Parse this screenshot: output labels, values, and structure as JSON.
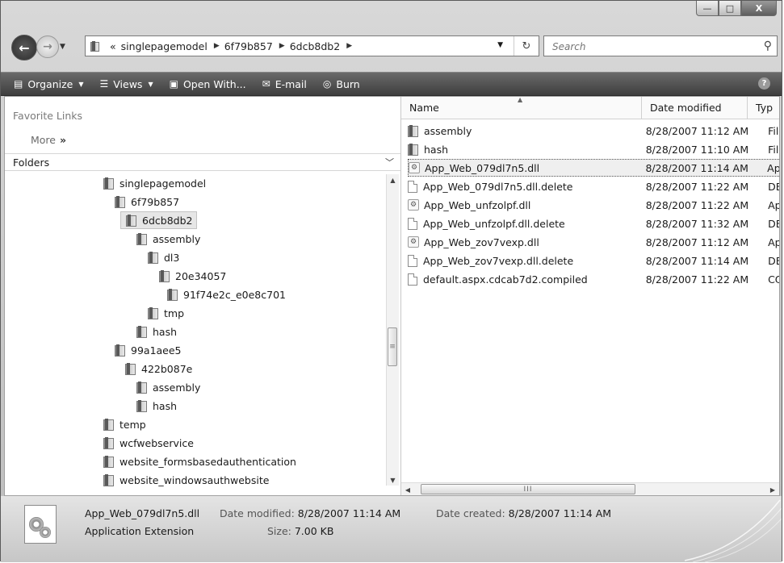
{
  "window": {
    "minimize_label": "—",
    "maximize_label": "□",
    "close_label": "X"
  },
  "address": {
    "overflow": "«",
    "crumbs": [
      "singlepagemodel",
      "6f79b857",
      "6dcb8db2"
    ],
    "refresh": "↻"
  },
  "search": {
    "placeholder": "Search"
  },
  "toolbar": {
    "organize": "Organize",
    "views": "Views",
    "open_with": "Open With...",
    "email": "E-mail",
    "burn": "Burn",
    "help": "?"
  },
  "nav": {
    "favorite_links": "Favorite Links",
    "more": "More",
    "more_chevron": "»",
    "folders": "Folders",
    "tree": [
      {
        "label": "singlepagemodel"
      },
      {
        "label": "6f79b857"
      },
      {
        "label": "6dcb8db2",
        "selected": true
      },
      {
        "label": "assembly"
      },
      {
        "label": "dl3"
      },
      {
        "label": "20e34057"
      },
      {
        "label": "91f74e2c_e0e8c701"
      },
      {
        "label": "tmp"
      },
      {
        "label": "hash"
      },
      {
        "label": "99a1aee5"
      },
      {
        "label": "422b087e"
      },
      {
        "label": "assembly"
      },
      {
        "label": "hash"
      },
      {
        "label": "temp"
      },
      {
        "label": "wcfwebservice"
      },
      {
        "label": "website_formsbasedauthentication"
      },
      {
        "label": "website_windowsauthwebsite"
      }
    ]
  },
  "files": {
    "columns": {
      "name": "Name",
      "date": "Date modified",
      "type": "Typ"
    },
    "rows": [
      {
        "name": "assembly",
        "date": "8/28/2007 11:12 AM",
        "type": "File",
        "kind": "folder"
      },
      {
        "name": "hash",
        "date": "8/28/2007 11:10 AM",
        "type": "File",
        "kind": "folder"
      },
      {
        "name": "App_Web_079dl7n5.dll",
        "date": "8/28/2007 11:14 AM",
        "type": "Ap",
        "kind": "dll",
        "selected": true
      },
      {
        "name": "App_Web_079dl7n5.dll.delete",
        "date": "8/28/2007 11:22 AM",
        "type": "DE",
        "kind": "file"
      },
      {
        "name": "App_Web_unfzolpf.dll",
        "date": "8/28/2007 11:22 AM",
        "type": "Ap",
        "kind": "dll"
      },
      {
        "name": "App_Web_unfzolpf.dll.delete",
        "date": "8/28/2007 11:32 AM",
        "type": "DE",
        "kind": "file"
      },
      {
        "name": "App_Web_zov7vexp.dll",
        "date": "8/28/2007 11:12 AM",
        "type": "Ap",
        "kind": "dll"
      },
      {
        "name": "App_Web_zov7vexp.dll.delete",
        "date": "8/28/2007 11:14 AM",
        "type": "DE",
        "kind": "file"
      },
      {
        "name": "default.aspx.cdcab7d2.compiled",
        "date": "8/28/2007 11:22 AM",
        "type": "CO",
        "kind": "file"
      }
    ]
  },
  "details": {
    "filename": "App_Web_079dl7n5.dll",
    "modified_label": "Date modified:",
    "modified_value": "8/28/2007 11:14 AM",
    "created_label": "Date created:",
    "created_value": "8/28/2007 11:14 AM",
    "type": "Application Extension",
    "size_label": "Size:",
    "size_value": "7.00 KB"
  }
}
